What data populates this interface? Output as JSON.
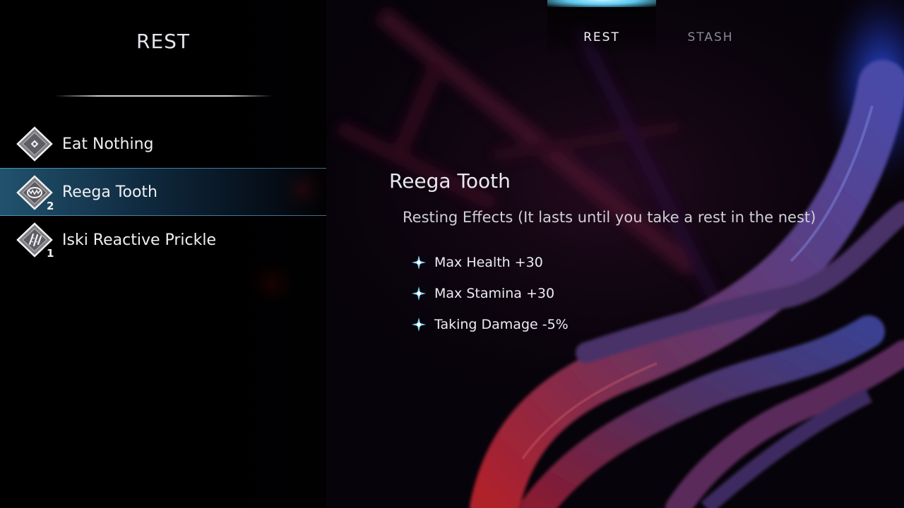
{
  "panel": {
    "title": "REST",
    "items": [
      {
        "label": "Eat Nothing",
        "icon": "rest-nothing-icon",
        "count": ""
      },
      {
        "label": "Reega Tooth",
        "icon": "reega-tooth-icon",
        "count": "2",
        "selected": true
      },
      {
        "label": "Iski Reactive Prickle",
        "icon": "prickle-icon",
        "count": "1"
      }
    ]
  },
  "tabs": {
    "rest": "REST",
    "stash": "STASH",
    "active": "rest"
  },
  "detail": {
    "title": "Reega Tooth",
    "subtitle": "Resting Effects (It lasts until you take a rest in the nest)",
    "effects": [
      "Max Health +30",
      "Max Stamina +30",
      "Taking Damage -5%"
    ]
  },
  "colors": {
    "accent": "#5cc9ef",
    "selected_row": "#2a6f9a",
    "text": "#e8e8ec",
    "inactive_tab": "#8a8a94"
  }
}
